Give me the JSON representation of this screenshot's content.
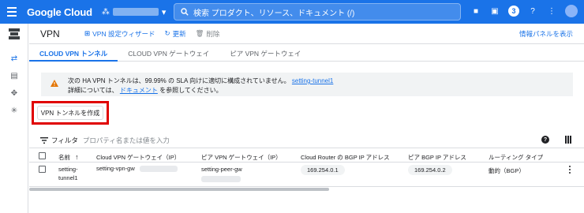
{
  "topbar": {
    "brand": "Google Cloud",
    "search_text": "検索  プロダクト、リソース、ドキュメント (/)",
    "notification_count": "3",
    "accent": "#1a73e8"
  },
  "header": {
    "title": "VPN",
    "wizard_label": "VPN 設定ウィザード",
    "refresh_label": "更新",
    "delete_label": "削除",
    "info_panel_label": "情報パネルを表示"
  },
  "tabs": [
    {
      "label": "CLOUD VPN トンネル",
      "active": true
    },
    {
      "label": "CLOUD VPN ゲートウェイ",
      "active": false
    },
    {
      "label": "ピア VPN ゲートウェイ",
      "active": false
    }
  ],
  "warning": {
    "line1": "次の HA VPN トンネルは、99.99% の SLA 向けに適切に構成されていません。",
    "tunnel_link": "setting-tunnel1",
    "line2_prefix": "詳細については、",
    "doc_link": "ドキュメント",
    "line2_suffix": "を参照してください。"
  },
  "create_button": "VPN トンネルを作成",
  "filter": {
    "label": "フィルタ",
    "placeholder": "プロパティ名または値を入力"
  },
  "table": {
    "headers": {
      "name": "名前",
      "vpn_gateway": "Cloud VPN ゲートウェイ（IP）",
      "peer_gateway": "ピア VPN ゲートウェイ（IP）",
      "router_bgp": "Cloud Router の BGP IP アドレス",
      "peer_bgp": "ピア BGP IP アドレス",
      "routing_type": "ルーティング タイプ"
    },
    "rows": [
      {
        "name_line1": "setting-",
        "name_line2": "tunnel1",
        "vpn_gateway": "setting-vpn-gw",
        "peer_gateway": "setting-peer-gw",
        "router_bgp": "169.254.0.1",
        "peer_bgp": "169.254.0.2",
        "routing_type": "動的（BGP）"
      }
    ]
  }
}
